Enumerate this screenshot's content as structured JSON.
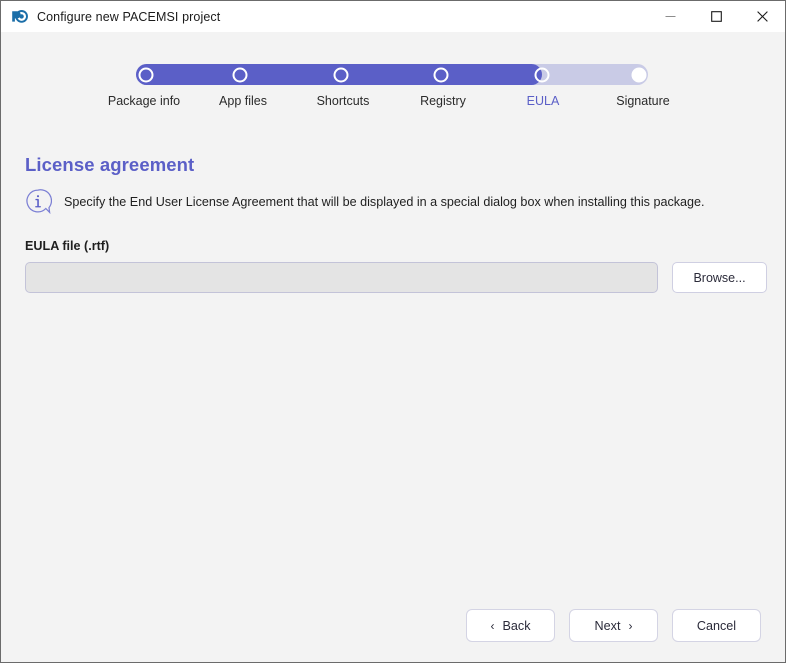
{
  "window": {
    "title": "Configure new PACEMSI project",
    "app_icon": "pace-logo-icon",
    "controls": {
      "minimize": "minimize-icon",
      "maximize": "maximize-icon",
      "close": "close-icon"
    }
  },
  "stepper": {
    "current_index": 4,
    "completed_fraction": 79.2,
    "track_color": "#c9cbe6",
    "fill_color": "#5b5fc7",
    "active_label_color": "#5b5fc7",
    "steps": [
      {
        "label": "Package info",
        "state": "done"
      },
      {
        "label": "App files",
        "state": "done"
      },
      {
        "label": "Shortcuts",
        "state": "done"
      },
      {
        "label": "Registry",
        "state": "done"
      },
      {
        "label": "EULA",
        "state": "active"
      },
      {
        "label": "Signature",
        "state": "pending"
      }
    ]
  },
  "content": {
    "title": "License agreement",
    "info_icon": "info-bubble-icon",
    "description": "Specify the End User License Agreement that will be displayed in a special dialog box when installing this package.",
    "field": {
      "label": "EULA file (.rtf)",
      "value": "",
      "placeholder": "",
      "browse_label": "Browse..."
    }
  },
  "footer": {
    "back_label": "Back",
    "back_chevron": "‹",
    "next_label": "Next",
    "next_chevron": "›",
    "cancel_label": "Cancel"
  }
}
